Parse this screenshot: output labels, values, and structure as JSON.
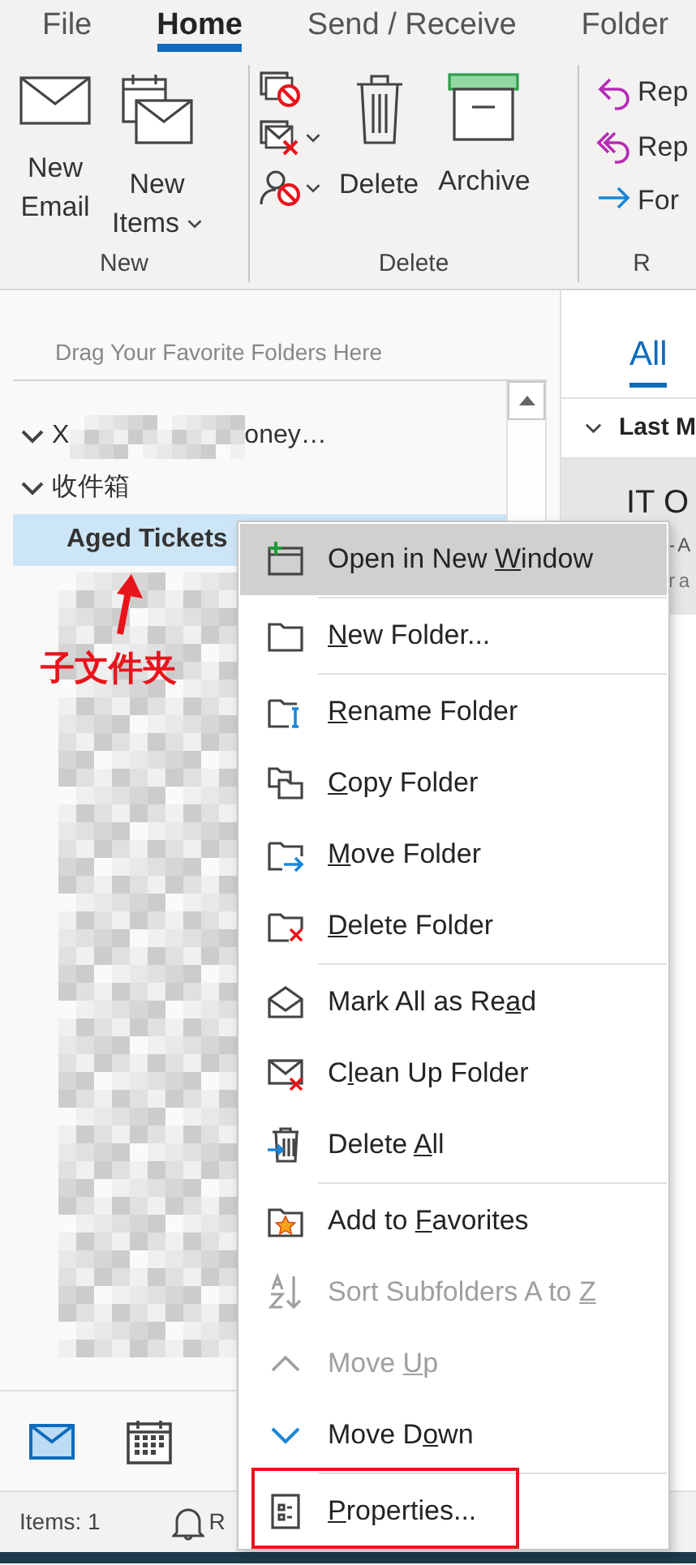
{
  "ribbon": {
    "tabs": [
      {
        "label": "File",
        "selected": false
      },
      {
        "label": "Home",
        "selected": true
      },
      {
        "label": "Send / Receive",
        "selected": false
      },
      {
        "label": "Folder",
        "selected": false
      }
    ],
    "groups": [
      {
        "label": "New",
        "items": [
          {
            "kind": "large",
            "lines": [
              "New",
              "Email"
            ],
            "dropdown": false
          },
          {
            "kind": "large",
            "lines": [
              "New",
              "Items"
            ],
            "dropdown": true
          }
        ]
      },
      {
        "label": "Delete",
        "items": [
          {
            "kind": "stack",
            "buttons": [
              {
                "dropdown": false
              },
              {
                "dropdown": true
              },
              {
                "dropdown": true
              }
            ]
          },
          {
            "kind": "large",
            "lines": [
              "Delete"
            ],
            "dropdown": false
          },
          {
            "kind": "large",
            "lines": [
              "Archive"
            ],
            "dropdown": false
          }
        ]
      },
      {
        "label": "R",
        "items": [
          {
            "kind": "list",
            "buttons": [
              {
                "label": "Rep"
              },
              {
                "label": "Rep"
              },
              {
                "label": "For"
              }
            ]
          }
        ]
      }
    ]
  },
  "folder_pane": {
    "favorites_hint": "Drag Your Favorite Folders Here",
    "tree": [
      {
        "label": "X",
        "label_end": "oney…",
        "redacted": true,
        "expanded": true,
        "unread": false,
        "selected": false,
        "children": [
          {
            "label": "收件箱",
            "expanded": true,
            "unread": false,
            "selected": false,
            "children": [
              {
                "label": "Aged Tickets",
                "unread": true,
                "selected": true
              }
            ]
          }
        ]
      }
    ],
    "annotation": "子文件夹",
    "nav": [
      {
        "kind": "mail",
        "selected": true
      },
      {
        "kind": "calendar",
        "selected": false
      }
    ]
  },
  "message_pane": {
    "tabs": [
      {
        "label": "All",
        "selected": true
      }
    ],
    "sort_header": "Last M",
    "message": {
      "sender": "IT O",
      "line_2": "- A",
      "line_3": "r a",
      "selected": true
    }
  },
  "status_bar": {
    "items": "Items: 1",
    "reminders": "R"
  },
  "context_menu": {
    "groups": [
      [
        {
          "text": {
            "before": "Open in New ",
            "key": "W",
            "after": "indow"
          },
          "selected": true,
          "disabled": false,
          "marked": false
        }
      ],
      [
        {
          "text": {
            "key": "N",
            "after": "ew Folder..."
          },
          "selected": false,
          "disabled": false,
          "marked": false
        }
      ],
      [
        {
          "text": {
            "key": "R",
            "after": "ename Folder"
          },
          "selected": false,
          "disabled": false,
          "marked": false
        },
        {
          "text": {
            "key": "C",
            "after": "opy Folder"
          },
          "selected": false,
          "disabled": false,
          "marked": false
        },
        {
          "text": {
            "key": "M",
            "after": "ove Folder"
          },
          "selected": false,
          "disabled": false,
          "marked": false
        },
        {
          "text": {
            "key": "D",
            "after": "elete Folder"
          },
          "selected": false,
          "disabled": false,
          "marked": false
        }
      ],
      [
        {
          "text": {
            "before": "Mark All as Re",
            "key": "a",
            "after": "d"
          },
          "selected": false,
          "disabled": false,
          "marked": false
        },
        {
          "text": {
            "before": "C",
            "key": "l",
            "after": "ean Up Folder"
          },
          "selected": false,
          "disabled": false,
          "marked": false
        },
        {
          "text": {
            "before": "Delete ",
            "key": "A",
            "after": "ll"
          },
          "selected": false,
          "disabled": false,
          "marked": false
        }
      ],
      [
        {
          "text": {
            "before": "Add to ",
            "key": "F",
            "after": "avorites"
          },
          "selected": false,
          "disabled": false,
          "marked": false
        },
        {
          "text": {
            "before": "Sort Subfolders A to ",
            "key": "Z"
          },
          "selected": false,
          "disabled": true,
          "marked": false
        },
        {
          "text": {
            "before": "Move ",
            "key": "U",
            "after": "p"
          },
          "selected": false,
          "disabled": true,
          "marked": false
        },
        {
          "text": {
            "before": "Move D",
            "key": "o",
            "after": "wn"
          },
          "selected": false,
          "disabled": false,
          "marked": false
        }
      ],
      [
        {
          "text": {
            "key": "P",
            "after": "roperties..."
          },
          "selected": false,
          "disabled": false,
          "marked": true
        }
      ]
    ]
  }
}
